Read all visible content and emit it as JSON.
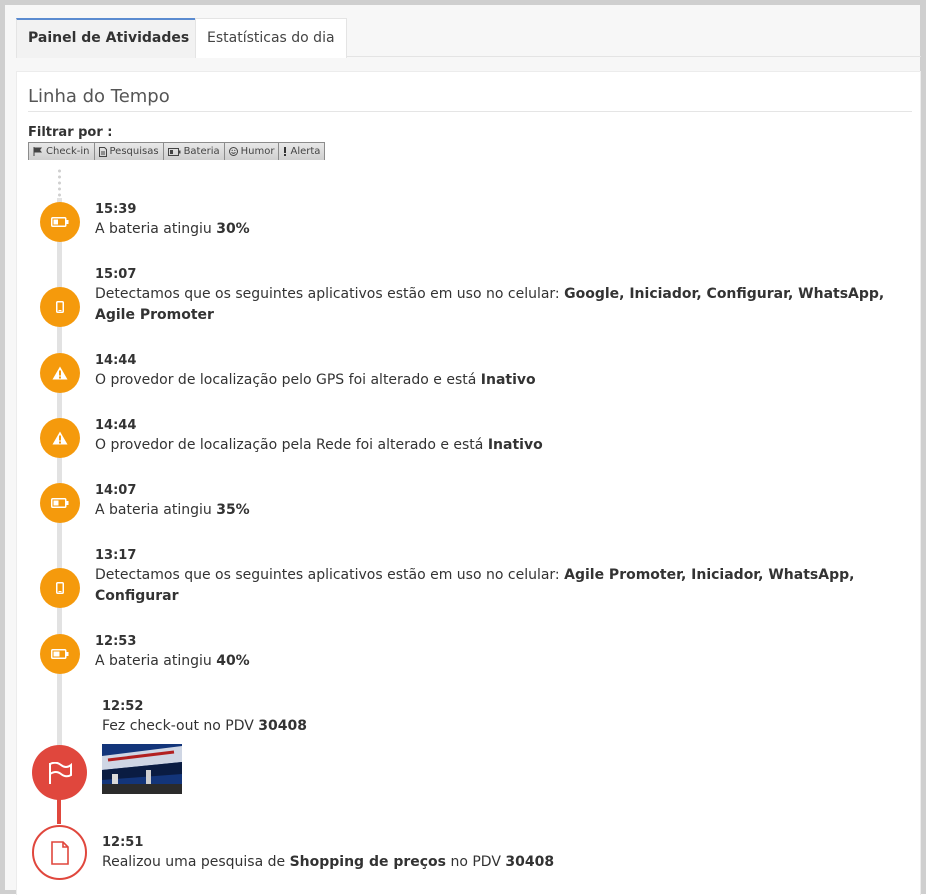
{
  "tabs": [
    {
      "label": "Painel de Atividades",
      "active": true
    },
    {
      "label": "Estatísticas do dia",
      "active": false
    }
  ],
  "panel": {
    "title": "Linha do Tempo",
    "filter_label": "Filtrar por :",
    "filters": [
      {
        "label": "Check-in",
        "icon": "flag-icon"
      },
      {
        "label": "Pesquisas",
        "icon": "document-icon"
      },
      {
        "label": "Bateria",
        "icon": "battery-icon"
      },
      {
        "label": "Humor",
        "icon": "smile-icon"
      },
      {
        "label": "Alerta",
        "icon": "exclamation-icon"
      }
    ]
  },
  "colors": {
    "warning": "#f59a0c",
    "danger": "#e0473d",
    "tab_accent": "#5b8bd0"
  },
  "timeline": [
    {
      "icon": "battery-icon",
      "time": "15:39",
      "text_pre": "A bateria atingiu ",
      "text_bold": "30%",
      "text_post": ""
    },
    {
      "icon": "phone-icon",
      "time": "15:07",
      "text_pre": "Detectamos que os seguintes aplicativos estão em uso no celular: ",
      "text_bold": "Google, Iniciador, Configurar, WhatsApp, Agile Promoter",
      "text_post": ""
    },
    {
      "icon": "warning-icon",
      "time": "14:44",
      "text_pre": "O provedor de localização pelo GPS foi alterado e está ",
      "text_bold": "Inativo",
      "text_post": ""
    },
    {
      "icon": "warning-icon",
      "time": "14:44",
      "text_pre": "O provedor de localização pela Rede foi alterado e está ",
      "text_bold": "Inativo",
      "text_post": ""
    },
    {
      "icon": "battery-icon",
      "time": "14:07",
      "text_pre": "A bateria atingiu ",
      "text_bold": "35%",
      "text_post": ""
    },
    {
      "icon": "phone-icon",
      "time": "13:17",
      "text_pre": "Detectamos que os seguintes aplicativos estão em uso no celular: ",
      "text_bold": "Agile Promoter, Iniciador, WhatsApp, Configurar",
      "text_post": ""
    },
    {
      "icon": "battery-icon",
      "time": "12:53",
      "text_pre": "A bateria atingiu ",
      "text_bold": "40%",
      "text_post": ""
    },
    {
      "icon": "flag-icon",
      "time": "12:52",
      "text_pre": "Fez check-out no PDV ",
      "text_bold": "30408",
      "text_post": ""
    },
    {
      "icon": "document-icon",
      "time": "12:51",
      "text_pre": "Realizou uma pesquisa de ",
      "text_bold": "Shopping de preços",
      "text_post": " no PDV ",
      "text_bold2": "30408"
    }
  ]
}
